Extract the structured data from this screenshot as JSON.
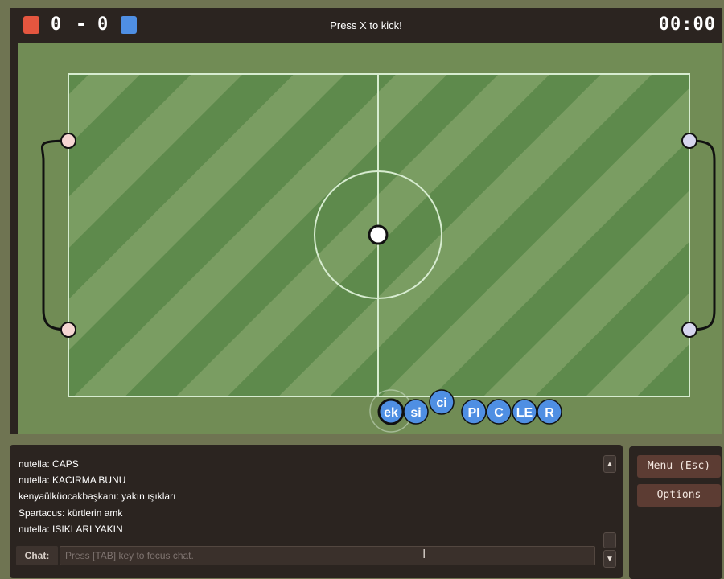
{
  "header": {
    "red_score": "0",
    "separator": "-",
    "blue_score": "0",
    "hint": "Press X to kick!",
    "timer": "00:00",
    "red_color": "#e4563f",
    "blue_color": "#4f8fe3"
  },
  "field": {
    "grass_dark": "#5e8a4c",
    "grass_light": "#7a9d62",
    "line_color": "#d7ecd0",
    "players": [
      {
        "label": "ek"
      },
      {
        "label": "si"
      },
      {
        "label": "ci"
      },
      {
        "label": "PI"
      },
      {
        "label": "C"
      },
      {
        "label": "LE"
      },
      {
        "label": "R"
      }
    ],
    "player_color": "#4f8fe3"
  },
  "chat": {
    "messages": [
      "nutella: CAPS",
      "nutella: KACIRMA BUNU",
      "kenyaülküocakbaşkanı: yakın ışıkları",
      "Spartacus: kürtlerin amk",
      "nutella: ISIKLARI YAKIN"
    ],
    "label": "Chat:",
    "placeholder": "Press [TAB] key to focus chat.",
    "scroll_up": "▲",
    "scroll_down": "▼"
  },
  "side_menu": {
    "menu_label": "Menu (Esc)",
    "options_label": "Options"
  }
}
